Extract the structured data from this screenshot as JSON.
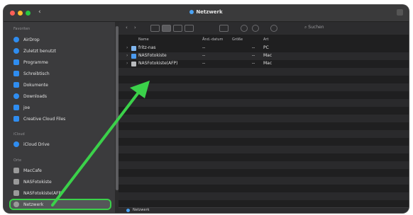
{
  "window": {
    "title": "Netzwerk",
    "back_symbol": "‹"
  },
  "sidebar": {
    "sections": [
      {
        "label": "Favoriten",
        "items": [
          {
            "label": "AirDrop",
            "icon": "airdrop-icon"
          },
          {
            "label": "Zuletzt benutzt",
            "icon": "clock-icon"
          },
          {
            "label": "Programme",
            "icon": "apps-icon"
          },
          {
            "label": "Schreibtisch",
            "icon": "desktop-icon"
          },
          {
            "label": "Dokumente",
            "icon": "document-icon"
          },
          {
            "label": "Downloads",
            "icon": "download-icon"
          },
          {
            "label": "joe",
            "icon": "home-icon"
          },
          {
            "label": "Creative Cloud Files",
            "icon": "cloud-files-icon"
          }
        ]
      },
      {
        "label": "iCloud",
        "items": [
          {
            "label": "iCloud Drive",
            "icon": "icloud-icon"
          }
        ]
      },
      {
        "label": "Orte",
        "items": [
          {
            "label": "MacCafe",
            "icon": "computer-icon"
          },
          {
            "label": "NASFotokiste",
            "icon": "display-icon"
          },
          {
            "label": "NASFotokiste(AFP)",
            "icon": "display-icon"
          },
          {
            "label": "Netzwerk",
            "icon": "network-icon",
            "active": true
          }
        ]
      }
    ]
  },
  "toolbar": {
    "nav": [
      "‹",
      "›"
    ],
    "search_placeholder": "Suchen"
  },
  "list": {
    "columns": [
      "Name",
      "Änd.-datum",
      "Größe",
      "Art"
    ],
    "rows": [
      {
        "name": "fritz-nas",
        "date": "--",
        "size": "--",
        "kind": "PC",
        "icon": "pc-icon"
      },
      {
        "name": "NASFotokiste",
        "date": "--",
        "size": "--",
        "kind": "Mac",
        "icon": "display-icon"
      },
      {
        "name": "NASFotokiste(AFP)",
        "date": "--",
        "size": "--",
        "kind": "Mac",
        "icon": "mac-icon"
      }
    ]
  },
  "pathbar": {
    "label": "Netzwerk"
  },
  "colors": {
    "accent": "#2f8df0",
    "highlight_arrow": "#3bd14a"
  }
}
